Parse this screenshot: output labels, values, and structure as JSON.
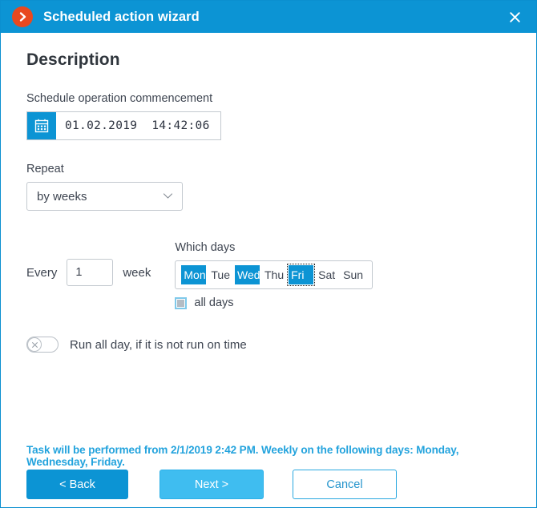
{
  "titlebar": {
    "logo_icon": "chevron-right-circle-icon",
    "title": "Scheduled action wizard",
    "close_icon": "close-icon"
  },
  "page": {
    "heading": "Description"
  },
  "schedule_start": {
    "label": "Schedule operation commencement",
    "calendar_icon": "calendar-icon",
    "value": "01.02.2019  14:42:06"
  },
  "repeat": {
    "label": "Repeat",
    "selected": "by weeks",
    "options": [
      "by weeks"
    ],
    "chevron_icon": "chevron-down-icon"
  },
  "every": {
    "prefix_label": "Every",
    "value": "1",
    "suffix_label": "week"
  },
  "which_days": {
    "label": "Which days",
    "days": [
      {
        "label": "Mon",
        "selected": true,
        "focused": false
      },
      {
        "label": "Tue",
        "selected": false,
        "focused": false
      },
      {
        "label": "Wed",
        "selected": true,
        "focused": false
      },
      {
        "label": "Thu",
        "selected": false,
        "focused": false
      },
      {
        "label": "Fri",
        "selected": true,
        "focused": true
      },
      {
        "label": "Sat",
        "selected": false,
        "focused": false
      },
      {
        "label": "Sun",
        "selected": false,
        "focused": false
      }
    ],
    "all_days_label": "all days",
    "all_days_checked": false
  },
  "run_all_day": {
    "label": "Run all day, if it is not run on time",
    "state": "off",
    "knob_icon": "cross-circle-icon"
  },
  "summary": {
    "text": "Task will be performed from 2/1/2019 2:42 PM. Weekly on the following days: Monday, Wednesday, Friday."
  },
  "footer": {
    "back_label": "< Back",
    "next_label": "Next >",
    "cancel_label": "Cancel"
  },
  "colors": {
    "accent_blue": "#0c94d4",
    "light_blue": "#3fbdf0",
    "logo_orange": "#e8491f",
    "summary_blue": "#23a3dd",
    "text_dark": "#3d4450"
  }
}
